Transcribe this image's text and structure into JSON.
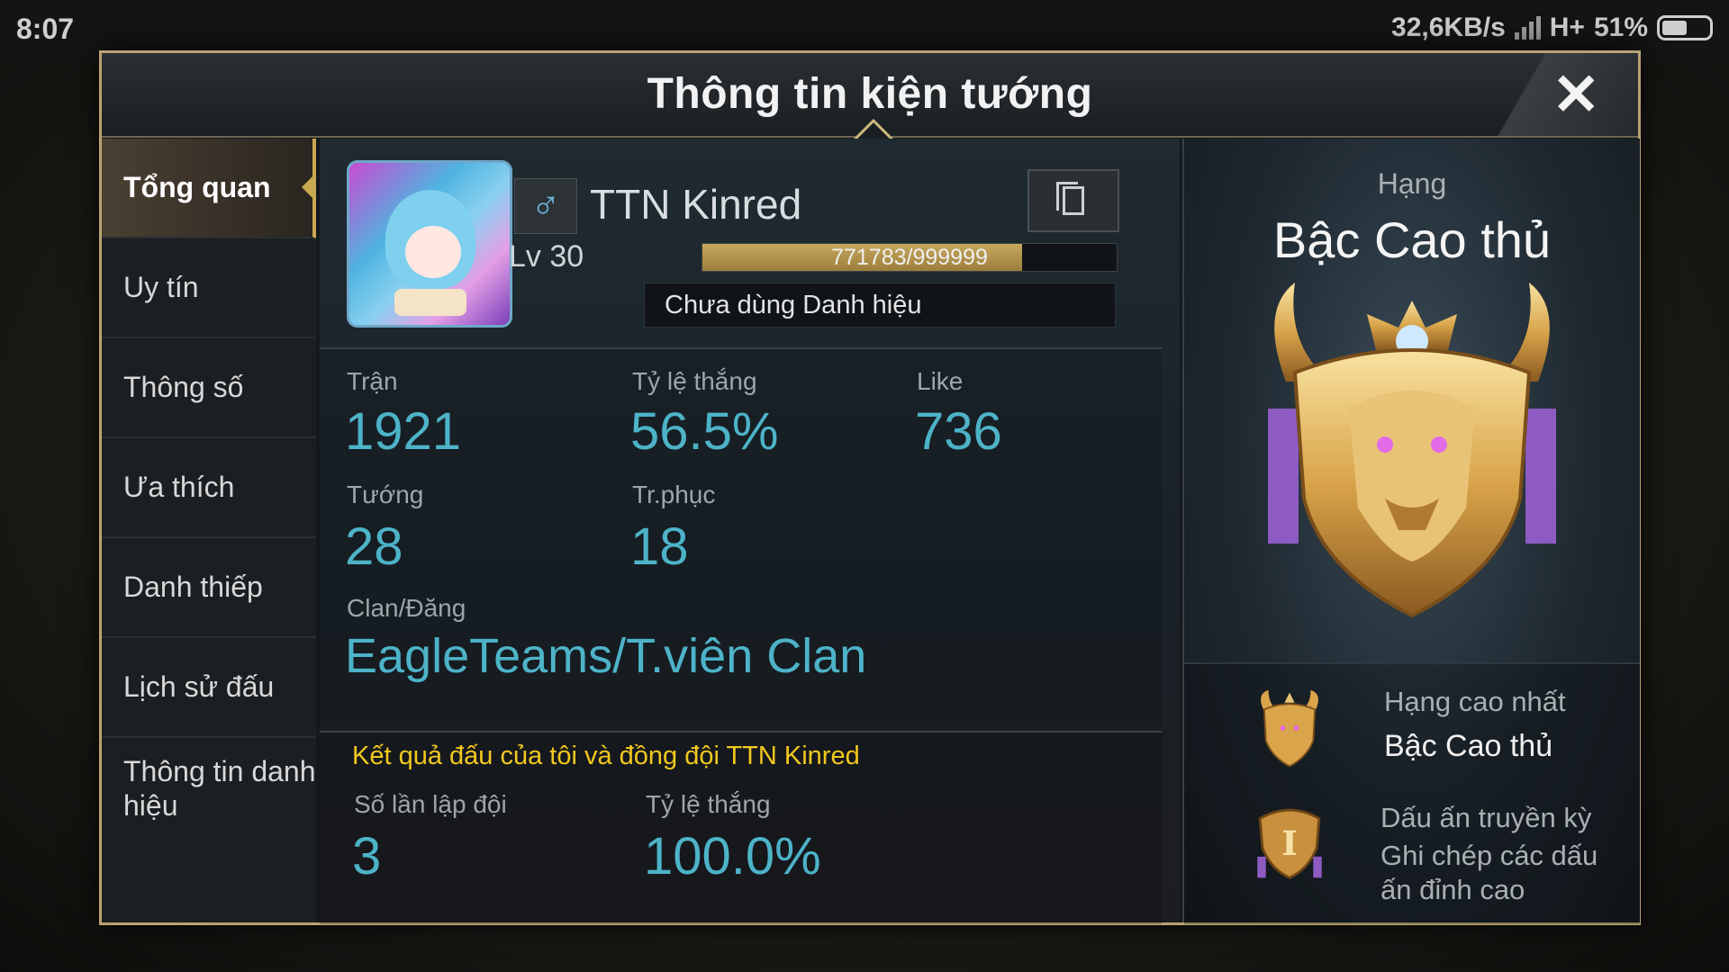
{
  "status_bar": {
    "time": "8:07",
    "speed": "32,6KB/s",
    "network": "H+",
    "battery": "51%"
  },
  "header": {
    "title": "Thông tin kiện tướng",
    "close_label": "✕"
  },
  "sidebar": {
    "items": [
      {
        "label": "Tổng quan"
      },
      {
        "label": "Uy tín"
      },
      {
        "label": "Thông số"
      },
      {
        "label": "Ưa thích"
      },
      {
        "label": "Danh thiếp"
      },
      {
        "label": "Lịch sử đấu"
      },
      {
        "label": "Thông tin danh hiệu"
      }
    ],
    "active_index": 0
  },
  "profile": {
    "gender_icon": "♂",
    "name": "TTN Kinred",
    "level": "Lv 30",
    "xp_text": "771783/999999",
    "xp_fraction": 0.772,
    "title_text": "Chưa dùng Danh hiệu"
  },
  "stats": {
    "matches_label": "Trận",
    "matches": "1921",
    "winrate_label": "Tỷ lệ thắng",
    "winrate": "56.5%",
    "like_label": "Like",
    "like": "736",
    "heroes_label": "Tướng",
    "heroes": "28",
    "skins_label": "Tr.phục",
    "skins": "18",
    "clan_label": "Clan/Đăng",
    "clan": "EagleTeams/T.viên Clan"
  },
  "teammate": {
    "title": "Kết quả đấu của tôi và đồng đội TTN Kinred",
    "team_count_label": "Số lần lập đội",
    "team_count": "3",
    "team_winrate_label": "Tỷ lệ thắng",
    "team_winrate": "100.0%"
  },
  "rank": {
    "label": "Hạng",
    "name": "Bậc Cao thủ",
    "highest_label": "Hạng cao nhất",
    "highest_value": "Bậc Cao thủ",
    "legend_title": "Dấu ấn truyền kỳ",
    "legend_line1": "Ghi chép các dấu",
    "legend_line2": "ấn đỉnh cao",
    "legend_numeral": "I"
  }
}
